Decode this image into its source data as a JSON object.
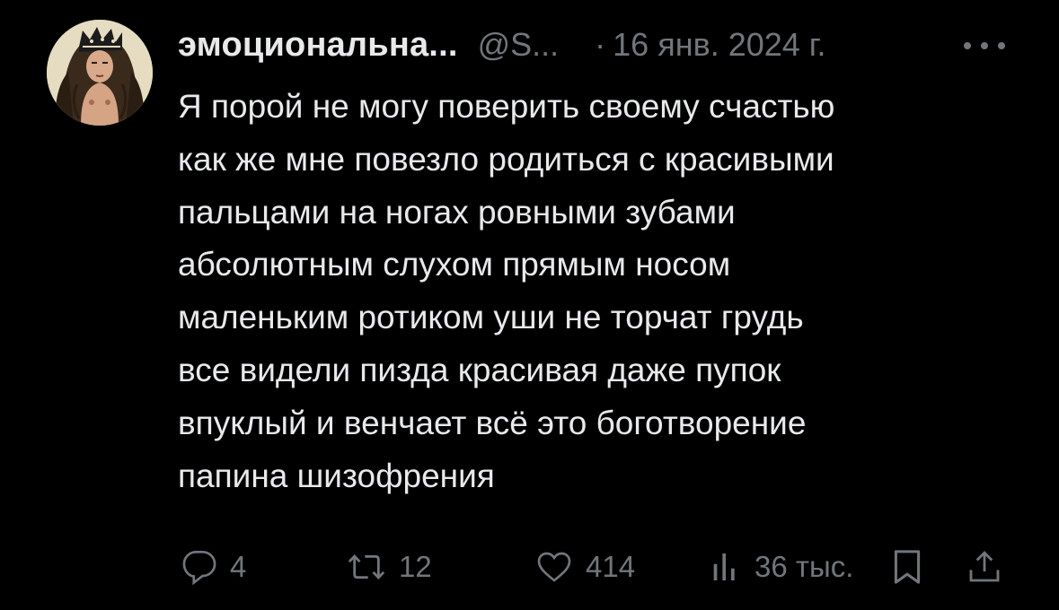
{
  "author": {
    "display_name": "эмоциональна...",
    "handle": "@S...",
    "separator": "·",
    "date": "16 янв. 2024 г."
  },
  "post": {
    "text": "Я порой не могу поверить своему счастью\nкак же мне повезло родиться с красивыми\nпальцами на ногах ровными зубами\nабсолютным слухом прямым носом\nмаленьким ротиком уши не торчат грудь\nвсе видели пизда красивая даже пупок\nвпуклый и венчает всё это боготворение\nпапина шизофрения"
  },
  "actions": {
    "replies": "4",
    "reposts": "12",
    "likes": "414",
    "views": "36 тыс."
  },
  "icons": {
    "more": "more-horizontal-icon",
    "reply": "reply-icon",
    "repost": "repost-icon",
    "like": "heart-icon",
    "views": "views-bar-chart-icon",
    "bookmark": "bookmark-icon",
    "share": "share-icon"
  },
  "colors": {
    "background": "#000000",
    "text_primary": "#e7e9ea",
    "text_secondary": "#71767b"
  }
}
